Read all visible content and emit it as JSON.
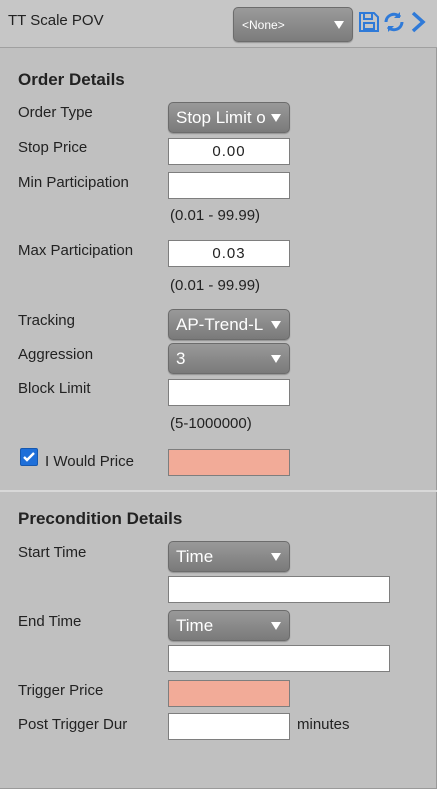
{
  "header": {
    "title": "TT Scale POV",
    "preset_value": "<None>",
    "icons": [
      "save-icon",
      "refresh-icon",
      "chevron-right-icon"
    ]
  },
  "order": {
    "heading": "Order Details",
    "order_type_label": "Order Type",
    "order_type_value": "Stop Limit o",
    "stop_price_label": "Stop Price",
    "stop_price_value": "0.00",
    "min_part_label": "Min Participation",
    "min_part_value": "",
    "min_part_hint": "(0.01 - 99.99)",
    "max_part_label": "Max Participation",
    "max_part_value": "0.03",
    "max_part_hint": "(0.01 - 99.99)",
    "tracking_label": "Tracking",
    "tracking_value": "AP-Trend-L",
    "aggression_label": "Aggression",
    "aggression_value": "3",
    "block_limit_label": "Block Limit",
    "block_limit_value": "",
    "block_limit_hint": "(5-1000000)",
    "i_would_label": "I Would Price",
    "i_would_checked": true,
    "i_would_value": ""
  },
  "precondition": {
    "heading": "Precondition Details",
    "start_time_label": "Start Time",
    "start_time_mode": "Time",
    "start_time_value": "",
    "end_time_label": "End Time",
    "end_time_mode": "Time",
    "end_time_value": "",
    "trigger_price_label": "Trigger Price",
    "trigger_price_value": "",
    "post_trigger_label": "Post Trigger Dur",
    "post_trigger_value": "",
    "post_trigger_unit": "minutes"
  },
  "colors": {
    "accent_blue": "#1e6fd9",
    "input_pink": "#f2ab98",
    "panel_bg": "#c0c0c0"
  }
}
